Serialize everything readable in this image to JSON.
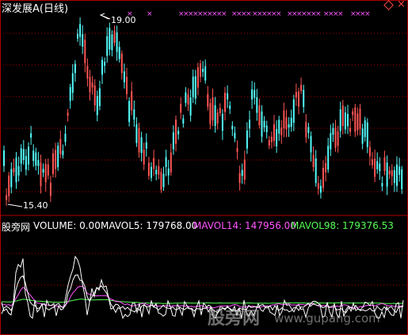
{
  "title": "深发展A(日线)",
  "price": {
    "high_label": "19.00",
    "low_label": "15.40"
  },
  "volume_legend": {
    "src": "股旁网",
    "volume": "VOLUME: 0.00",
    "mavol5": "MAVOL5: 179768.00",
    "mavol14": "MAVOL14: 147956.00",
    "mavol98": "MAVOL98: 179376.53"
  },
  "watermark": {
    "cn": "股旁网",
    "url": "www.gupang.com"
  },
  "colors": {
    "up": "#ff5555",
    "down": "#54fcfc",
    "mavol5": "#ffffff",
    "mavol14": "#ff55ff",
    "mavol98": "#55ff55",
    "grid": "#b00000",
    "marker": "#ff55ff"
  }
}
